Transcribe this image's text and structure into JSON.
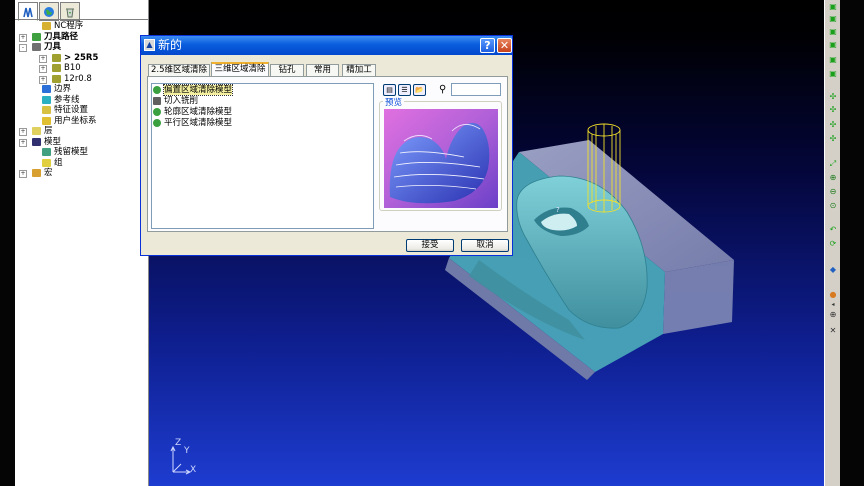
{
  "explorer": {
    "tabs": [
      {
        "icon": "toolpath-tree-icon"
      },
      {
        "icon": "globe-icon"
      },
      {
        "icon": "recycle-bin-icon"
      }
    ],
    "tree": [
      {
        "label": "NC程序",
        "bold": false,
        "toggle": "",
        "indent": 1,
        "icon": "nc-program-icon",
        "color": "#d8b030"
      },
      {
        "label": "刀具路径",
        "bold": true,
        "toggle": "+",
        "indent": 0,
        "icon": "toolpath-icon",
        "color": "#3fa040"
      },
      {
        "label": "刀具",
        "bold": true,
        "toggle": "-",
        "indent": 0,
        "icon": "tool-icon",
        "color": "#707070"
      },
      {
        "label": "> 25R5",
        "bold": true,
        "toggle": "+",
        "indent": 2,
        "icon": "tool-item-icon",
        "color": "#a0a030"
      },
      {
        "label": "B10",
        "bold": false,
        "toggle": "+",
        "indent": 2,
        "icon": "tool-item-icon",
        "color": "#a0a030"
      },
      {
        "label": "12r0.8",
        "bold": false,
        "toggle": "+",
        "indent": 2,
        "icon": "tool-item-icon",
        "color": "#a0a030"
      },
      {
        "label": "边界",
        "bold": false,
        "toggle": "",
        "indent": 1,
        "icon": "boundary-icon",
        "color": "#2a70d8"
      },
      {
        "label": "参考线",
        "bold": false,
        "toggle": "",
        "indent": 1,
        "icon": "pattern-icon",
        "color": "#2ab0c0"
      },
      {
        "label": "特征设置",
        "bold": false,
        "toggle": "",
        "indent": 1,
        "icon": "feature-set-icon",
        "color": "#d8c040"
      },
      {
        "label": "用户坐标系",
        "bold": false,
        "toggle": "",
        "indent": 1,
        "icon": "workplane-icon",
        "color": "#e0c030"
      },
      {
        "label": "层",
        "bold": false,
        "toggle": "+",
        "indent": 0,
        "icon": "layer-icon",
        "color": "#e0d060"
      },
      {
        "label": "模型",
        "bold": false,
        "toggle": "+",
        "indent": 0,
        "icon": "model-icon",
        "color": "#303070"
      },
      {
        "label": "残留模型",
        "bold": false,
        "toggle": "",
        "indent": 1,
        "icon": "stock-model-icon",
        "color": "#40a080"
      },
      {
        "label": "组",
        "bold": false,
        "toggle": "",
        "indent": 1,
        "icon": "group-icon",
        "color": "#e0d040"
      },
      {
        "label": "宏",
        "bold": false,
        "toggle": "+",
        "indent": 0,
        "icon": "macro-icon",
        "color": "#d8a030"
      }
    ]
  },
  "dialog": {
    "title": "新的",
    "help_button": "?",
    "close_button": "✕",
    "tabs": [
      "2.5维区域清除",
      "三维区域清除",
      "钻孔",
      "常用",
      "精加工"
    ],
    "active_tab": 1,
    "items": [
      {
        "label": "偏置区域清除模型",
        "selected": true,
        "icon": "strategy-icon"
      },
      {
        "label": "切入铣削",
        "selected": false,
        "icon": "plunge-icon"
      },
      {
        "label": "轮廓区域清除模型",
        "selected": false,
        "icon": "strategy-icon"
      },
      {
        "label": "平行区域清除模型",
        "selected": false,
        "icon": "strategy-icon"
      }
    ],
    "preview_label": "预览",
    "accept_button": "接受",
    "cancel_button": "取消",
    "search_value": ""
  },
  "axis": {
    "z": "Z",
    "y": "Y",
    "x": "X"
  },
  "colors": {
    "titlebar": "#0a5ddd",
    "dialog_bg": "#ece9d8",
    "model": "#4aa8b8",
    "block": "#8f96b8",
    "tool": "#f0e020",
    "viewport_bottom": "#1d3cd0"
  }
}
